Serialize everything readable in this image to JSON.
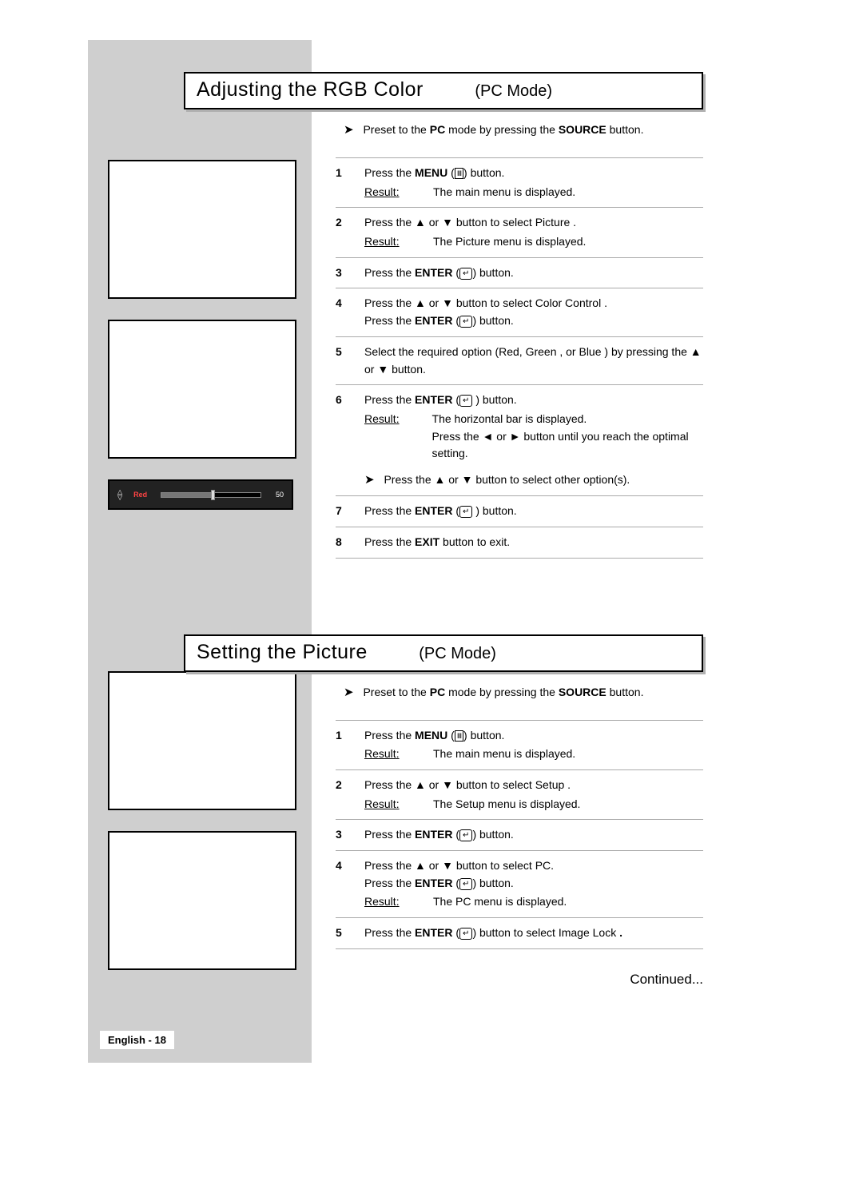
{
  "section1": {
    "title": "Adjusting the RGB Color",
    "mode": "(PC Mode)",
    "intro_pre": "Preset to the ",
    "intro_pc": "PC",
    "intro_mid": " mode by pressing the ",
    "intro_src": "SOURCE",
    "intro_post": " button.",
    "steps": [
      {
        "n": "1",
        "line1_pre": "Press the ",
        "line1_b": "MENU",
        "line1_post": " (",
        "line1_icon": "menu",
        "line1_close": ") button.",
        "result": "The main menu is displayed."
      },
      {
        "n": "2",
        "line": "Press the ▲ or ▼ button to select Picture .",
        "result": "The Picture  menu is displayed."
      },
      {
        "n": "3",
        "line1_pre": "Press the ",
        "line1_b": "ENTER",
        "line1_post": " (",
        "line1_icon": "enter",
        "line1_close": ") button."
      },
      {
        "n": "4",
        "line": "Press the ▲ or ▼ button to select Color Control .",
        "line2_pre": "Press the ",
        "line2_b": "ENTER",
        "line2_post": " (",
        "line2_icon": "enter",
        "line2_close": ") button."
      },
      {
        "n": "5",
        "line": "Select the required option (Red, Green , or Blue ) by pressing the ▲ or ▼ button."
      },
      {
        "n": "6",
        "line1_pre": "Press the ",
        "line1_b": "ENTER",
        "line1_post": " (",
        "line1_icon": "enter",
        "line1_close": " ) button.",
        "result": "The horizontal bar is displayed.",
        "result2": "Press the ◄ or ► button until you reach the optimal setting.",
        "note": "Press the ▲ or ▼ button to select other option(s)."
      },
      {
        "n": "7",
        "line1_pre": "Press the ",
        "line1_b": "ENTER",
        "line1_post": " (",
        "line1_icon": "enter",
        "line1_close": " ) button."
      },
      {
        "n": "8",
        "line_pre": "Press the ",
        "line_b": "EXIT",
        "line_post": " button to exit."
      }
    ]
  },
  "osd": {
    "label": "Red",
    "value": "50"
  },
  "section2": {
    "title": "Setting the Picture",
    "mode": "(PC Mode)",
    "intro_pre": "Preset to the ",
    "intro_pc": "PC",
    "intro_mid": " mode by pressing the ",
    "intro_src": "SOURCE",
    "intro_post": " button.",
    "steps": [
      {
        "n": "1",
        "line1_pre": "Press the ",
        "line1_b": "MENU",
        "line1_post": " (",
        "line1_icon": "menu",
        "line1_close": ") button.",
        "result": "The main menu is displayed."
      },
      {
        "n": "2",
        "line": "Press the ▲ or ▼ button to select Setup .",
        "result": "The Setup  menu is displayed."
      },
      {
        "n": "3",
        "line1_pre": "Press the ",
        "line1_b": "ENTER",
        "line1_post": " (",
        "line1_icon": "enter",
        "line1_close": ") button."
      },
      {
        "n": "4",
        "line": "Press the ▲ or ▼ button to select PC.",
        "line2_pre": "Press the ",
        "line2_b": "ENTER",
        "line2_post": " (",
        "line2_icon": "enter",
        "line2_close": ") button.",
        "result": "The PC  menu is displayed."
      },
      {
        "n": "5",
        "line1_pre": "Press the ",
        "line1_b": "ENTER",
        "line1_post": " (",
        "line1_icon": "enter",
        "line1_close": ") button to select Image Lock ",
        "tail_bold": "."
      }
    ],
    "continued": "Continued..."
  },
  "footer": {
    "lang": "English - 18"
  },
  "labels": {
    "result": "Result"
  }
}
